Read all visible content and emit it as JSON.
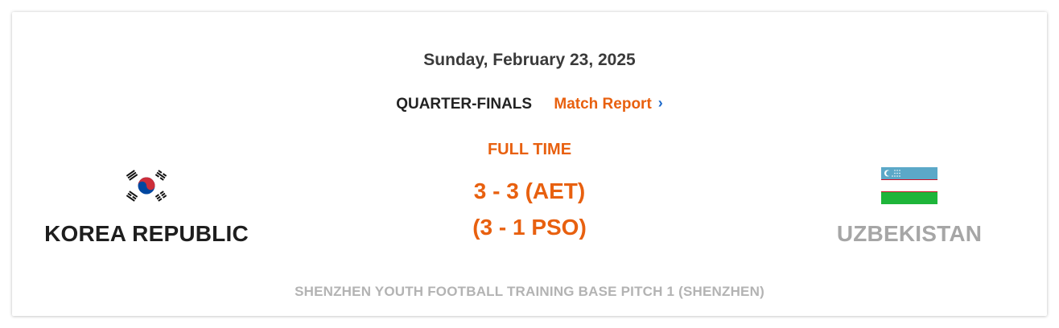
{
  "match": {
    "date": "Sunday, February 23, 2025",
    "stage": "QUARTER-FINALS",
    "report_link": "Match Report",
    "chevron": "›",
    "status": "FULL TIME",
    "score": "3 - 3 (AET)",
    "penalties": "(3 - 1 PSO)",
    "venue": "SHENZHEN YOUTH FOOTBALL TRAINING BASE PITCH 1 (SHENZHEN)"
  },
  "home": {
    "name": "KOREA REPUBLIC",
    "flag": "korea-flag-icon"
  },
  "away": {
    "name": "UZBEKISTAN",
    "flag": "uzbekistan-flag-icon"
  },
  "colors": {
    "accent": "#e8600f",
    "link_chevron": "#1a67c9",
    "home_name": "#1e1e1e",
    "away_name": "#a6a6a6",
    "venue": "#b3b3b3"
  }
}
